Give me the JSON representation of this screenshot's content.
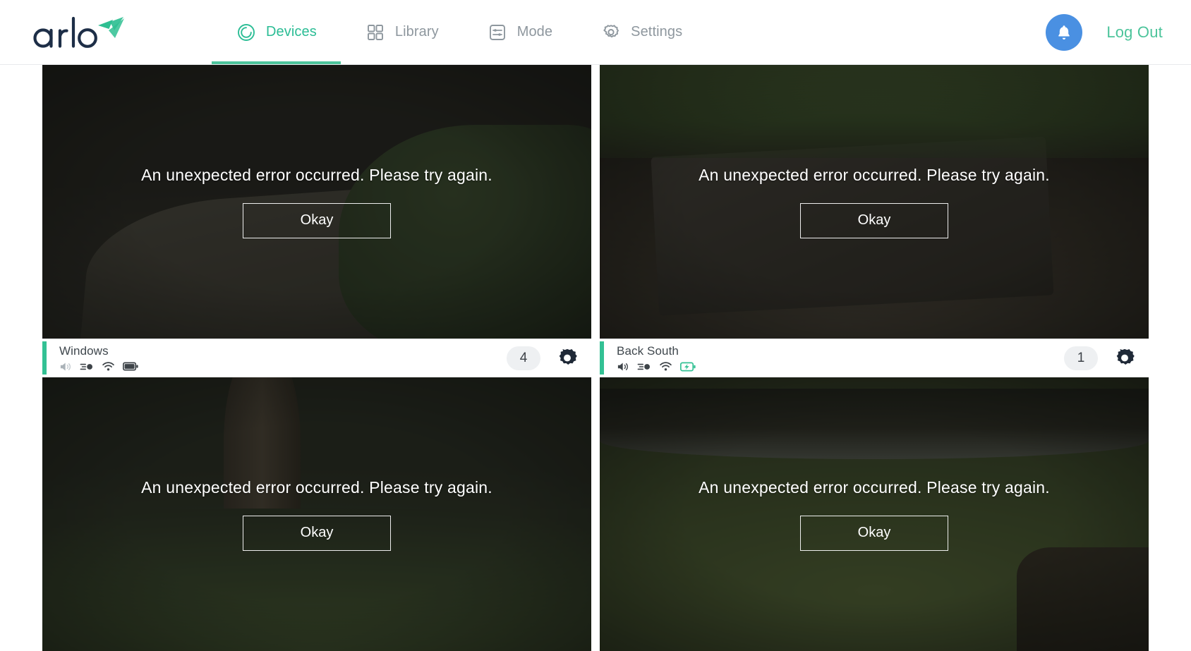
{
  "brand": {
    "name": "arlo",
    "logo_icon": "arlo-bird-logo",
    "logo_color": "#1d2e47",
    "accent_color": "#2fbf92"
  },
  "header": {
    "nav": [
      {
        "label": "Devices",
        "icon": "devices-circle-icon",
        "active": true
      },
      {
        "label": "Library",
        "icon": "library-grid-icon",
        "active": false
      },
      {
        "label": "Mode",
        "icon": "mode-sliders-icon",
        "active": false
      },
      {
        "label": "Settings",
        "icon": "settings-gear-icon",
        "active": false
      }
    ],
    "notifications_icon": "bell-icon",
    "notifications_color": "#4a90e2",
    "logout_label": "Log Out",
    "logout_color": "#4cc49b"
  },
  "error_overlay": {
    "message": "An unexpected error occurred. Please try again.",
    "button_label": "Okay"
  },
  "cameras": [
    {
      "name": "",
      "scene": "driveway-front-yard",
      "show_bar": false,
      "badge": "",
      "status_icons": [],
      "has_error": true
    },
    {
      "name": "",
      "scene": "covered-patio-table",
      "show_bar": false,
      "badge": "",
      "status_icons": [],
      "has_error": true
    },
    {
      "name": "Windows",
      "scene": "front-yard-tree",
      "show_bar": true,
      "badge": "4",
      "accent_color": "#33c194",
      "status_icons": [
        {
          "icon": "speaker-muted-icon",
          "state": "muted",
          "color": "#b9c0c6"
        },
        {
          "icon": "motion-sensor-icon",
          "state": "on",
          "color": "#3d4348"
        },
        {
          "icon": "wifi-icon",
          "state": "connected",
          "color": "#3d4348"
        },
        {
          "icon": "battery-full-icon",
          "state": "full",
          "color": "#3d4348"
        }
      ],
      "settings_icon": "gear-icon",
      "has_error": true
    },
    {
      "name": "Back South",
      "scene": "back-yard-lawn",
      "show_bar": true,
      "badge": "1",
      "accent_color": "#33c194",
      "status_icons": [
        {
          "icon": "speaker-muted-icon",
          "state": "muted",
          "color": "#3d4348"
        },
        {
          "icon": "motion-sensor-icon",
          "state": "on",
          "color": "#3d4348"
        },
        {
          "icon": "wifi-icon",
          "state": "connected",
          "color": "#3d4348"
        },
        {
          "icon": "battery-charging-icon",
          "state": "charging",
          "color": "#33c194"
        }
      ],
      "settings_icon": "gear-icon",
      "has_error": true
    }
  ]
}
